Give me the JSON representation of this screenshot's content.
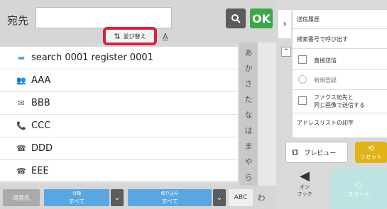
{
  "header": {
    "destination_label": "宛先",
    "destination_value": "",
    "ok_label": "OK",
    "sort_label": "並び替え",
    "abc_label": "A"
  },
  "list": {
    "rows": [
      {
        "icon": "search-registration-icon",
        "glyph": "▬",
        "text": "search 0001 register 0001"
      },
      {
        "icon": "group-icon",
        "glyph": "👥",
        "text": "AAA"
      },
      {
        "icon": "email-icon",
        "glyph": "✉",
        "text": "BBB"
      },
      {
        "icon": "phone-icon",
        "glyph": "📞",
        "text": "CCC"
      },
      {
        "icon": "fax-icon",
        "glyph": "☎",
        "text": "DDD"
      },
      {
        "icon": "fax-icon",
        "glyph": "☎",
        "text": "EEE"
      }
    ]
  },
  "index": [
    "あ",
    "か",
    "さ",
    "た",
    "な",
    "は",
    "ま",
    "や",
    "ら",
    "わ"
  ],
  "bottom": {
    "favorites_label": "得意先",
    "category": {
      "label": "分類",
      "value": "すべて"
    },
    "filter": {
      "label": "絞り込み",
      "value": "すべて"
    },
    "abc_label": "ABC",
    "wa_label": "わ"
  },
  "panel": {
    "send_history": "送信履歴",
    "call_by_search": "検索番号で呼び出す",
    "direct_send": "直接送信",
    "new_register": "新規登録",
    "fax_same_image_line1": "ファクス宛先と",
    "fax_same_image_line2": "同じ画像で送信する",
    "address_print": "アドレスリストの印字",
    "preview": "プレビュー",
    "reset": "リセット",
    "onhook_line1": "オン",
    "onhook_line2": "フック",
    "start": "スタート"
  },
  "colors": {
    "ok_green": "#3aa84a",
    "highlight_red": "#d6243f",
    "combo_blue": "#5aa6e0",
    "reset_yellow": "#e0b418",
    "start_teal": "#bde4e3"
  }
}
